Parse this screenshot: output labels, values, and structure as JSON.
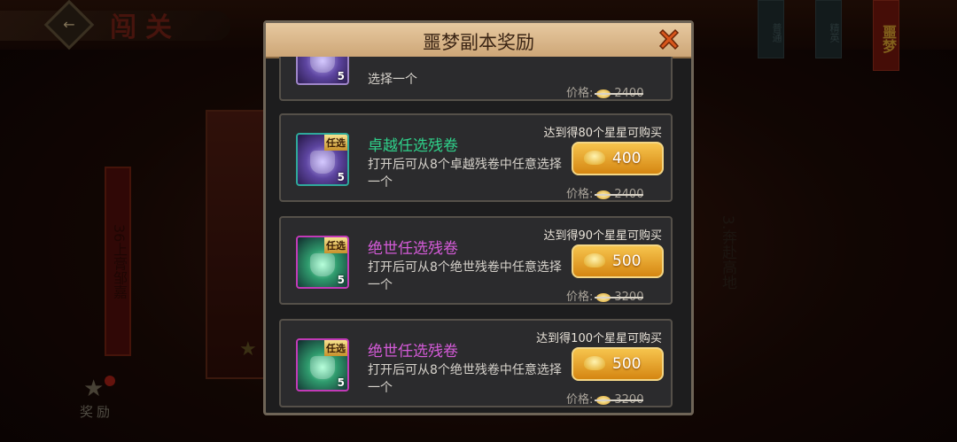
{
  "background": {
    "stage_title": "闯关",
    "tabs": [
      "普通",
      "精英",
      "噩梦"
    ],
    "left_scroll_text": "36上膏邹嘉",
    "right_scroll_text": "3.奔赴高地",
    "reward_label": "奖励"
  },
  "dialog": {
    "title": "噩梦副本奖励",
    "price_label": "价格:",
    "items": [
      {
        "name": "",
        "name_color": "#b06be0",
        "desc": "选择一个",
        "requirement": "",
        "price": "",
        "original_price": "2400",
        "count": "5",
        "tag": "",
        "icon": "purple-chest-icon"
      },
      {
        "name": "卓越任选残卷",
        "name_color": "#2fd08a",
        "desc": "打开后可从8个卓越残卷中任意选择一个",
        "requirement": "达到得80个星星可购买",
        "price": "400",
        "original_price": "2400",
        "count": "5",
        "tag": "任选",
        "icon": "purple-chest-icon"
      },
      {
        "name": "绝世任选残卷",
        "name_color": "#d45bd8",
        "desc": "打开后可从8个绝世残卷中任意选择一个",
        "requirement": "达到得90个星星可购买",
        "price": "500",
        "original_price": "3200",
        "count": "5",
        "tag": "任选",
        "icon": "green-chest-icon"
      },
      {
        "name": "绝世任选残卷",
        "name_color": "#d45bd8",
        "desc": "打开后可从8个绝世残卷中任意选择一个",
        "requirement": "达到得100个星星可购买",
        "price": "500",
        "original_price": "3200",
        "count": "5",
        "tag": "任选",
        "icon": "green-chest-icon"
      }
    ]
  }
}
